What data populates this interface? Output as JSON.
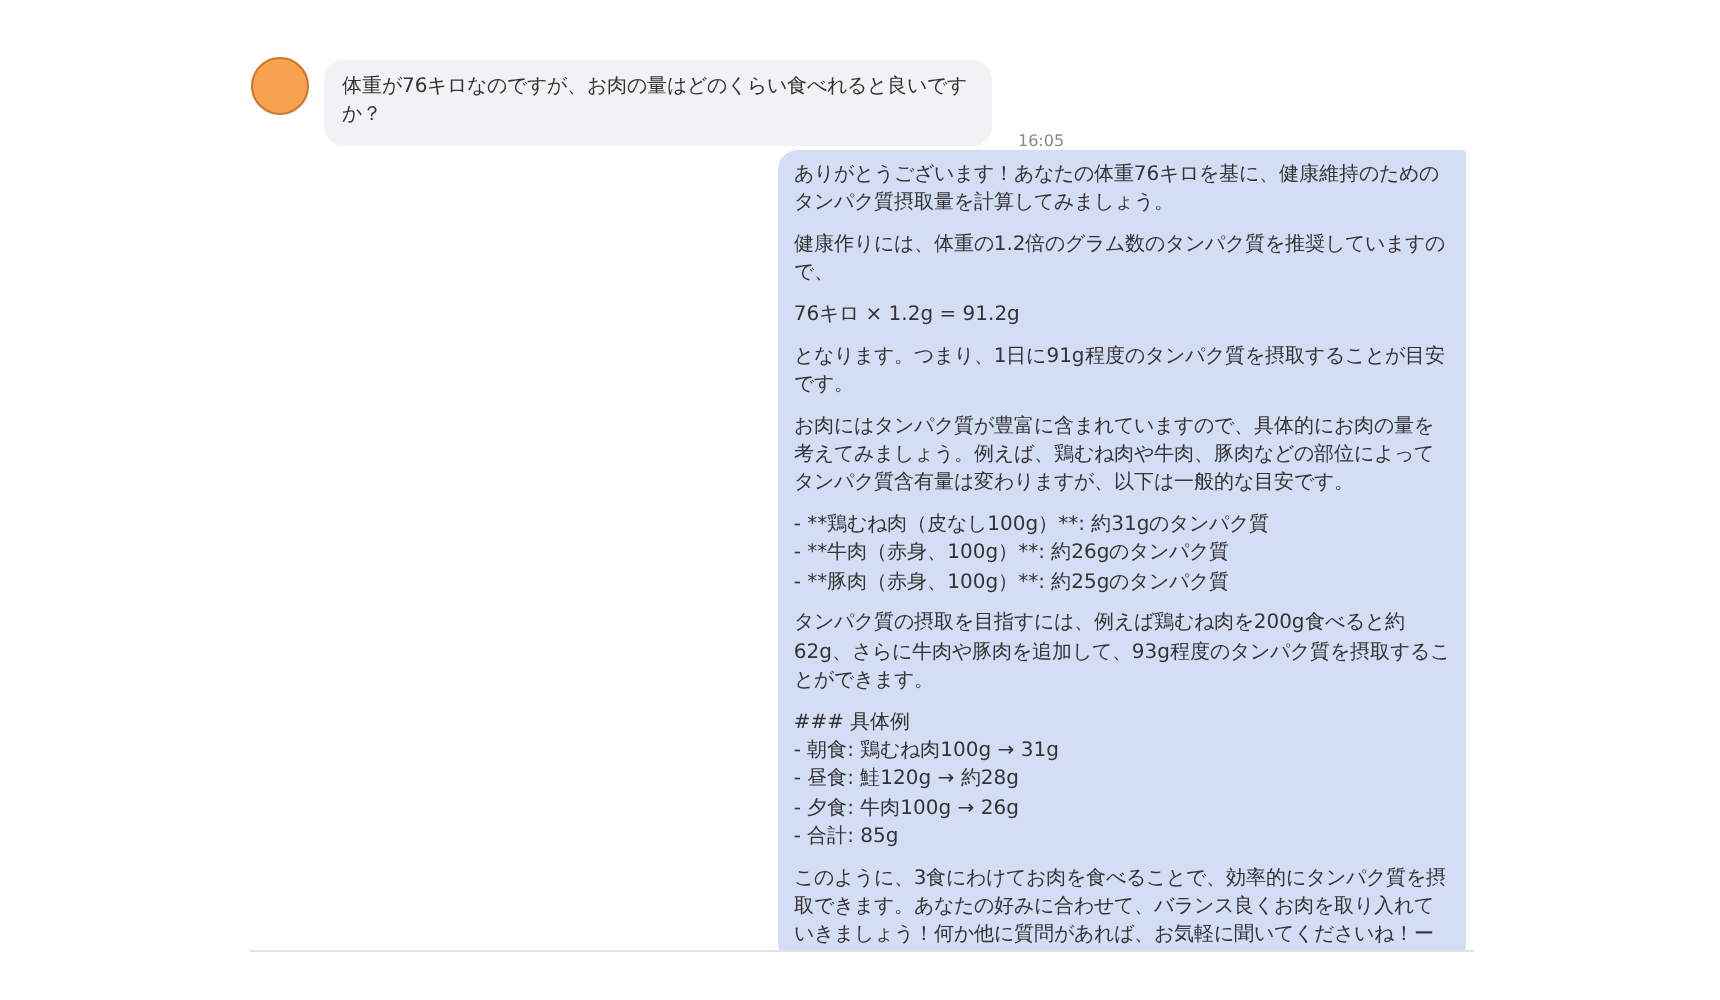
{
  "messages": [
    {
      "kind": "user",
      "paragraphs": [
        [
          "体重が76キロなのですが、お肉の量はどのくらい食べれると良いです",
          "か？"
        ]
      ],
      "time": "16:05"
    },
    {
      "kind": "assistant",
      "paragraphs": [
        [
          "ありがとうございます！あなたの体重76キロを基に、健康維持のための",
          "タンパク質摂取量を計算してみましょう。"
        ],
        [
          "健康作りには、体重の1.2倍のグラム数のタンパク質を推奨していますの",
          "で、"
        ],
        [
          "76キロ × 1.2g = 91.2g"
        ],
        [
          "となります。つまり、1日に91g程度のタンパク質を摂取することが目安",
          "です。"
        ],
        [
          "お肉にはタンパク質が豊富に含まれていますので、具体的にお肉の量を",
          "考えてみましょう。例えば、鶏むね肉や牛肉、豚肉などの部位によって",
          "タンパク質含有量は変わりますが、以下は一般的な目安です。"
        ],
        [
          "- **鶏むね肉（皮なし100g）**: 約31gのタンパク質",
          "- **牛肉（赤身、100g）**: 約26gのタンパク質",
          "- **豚肉（赤身、100g）**: 約25gのタンパク質"
        ],
        [
          "タンパク質の摂取を目指すには、例えば鶏むね肉を200g食べると約",
          "62g、さらに牛肉や豚肉を追加して、93g程度のタンパク質を摂取するこ",
          "とができます。"
        ],
        [
          "### 具体例",
          "- 朝食: 鶏むね肉100g → 31g",
          "- 昼食: 鮭120g → 約28g",
          "- 夕食: 牛肉100g → 26g",
          "- 合計: 85g"
        ],
        [
          "このように、3食にわけてお肉を食べることで、効率的にタンパク質を摂",
          "取できます。あなたの好みに合わせて、バランス良くお肉を取り入れて",
          "いきましょう！何か他に質問があれば、お気軽に聞いてくださいね！ー"
        ]
      ]
    }
  ]
}
